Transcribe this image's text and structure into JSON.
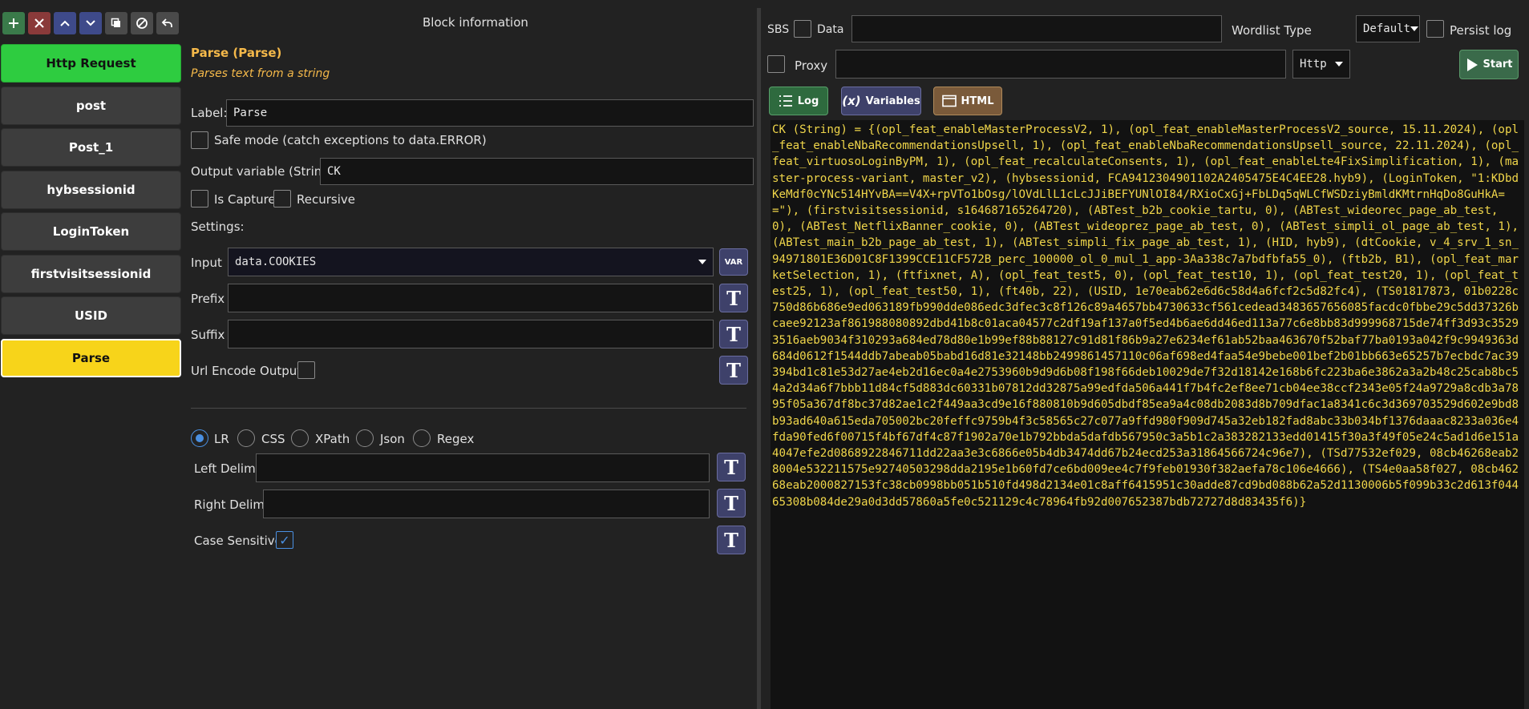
{
  "toolbar": {
    "icons": [
      "plus-icon",
      "x-icon",
      "chevron-up-icon",
      "chevron-down-icon",
      "clone-icon",
      "disable-icon",
      "undo-icon"
    ]
  },
  "blocks": [
    {
      "label": "Http Request",
      "kind": "request"
    },
    {
      "label": "post",
      "kind": "normal"
    },
    {
      "label": "Post_1",
      "kind": "normal"
    },
    {
      "label": "hybsessionid",
      "kind": "normal"
    },
    {
      "label": "LoginToken",
      "kind": "normal"
    },
    {
      "label": "firstvisitsessionid",
      "kind": "normal"
    },
    {
      "label": "USID",
      "kind": "normal"
    },
    {
      "label": "Parse",
      "kind": "selected"
    }
  ],
  "block_info": {
    "header": "Block information",
    "title": "Parse (Parse)",
    "description": "Parses text from a string",
    "label_label": "Label:",
    "label_value": "Parse",
    "safe_mode_label": "Safe mode (catch exceptions to data.ERROR)",
    "output_label": "Output variable (String)",
    "output_value": "CK",
    "is_capture_label": "Is Capture",
    "recursive_label": "Recursive",
    "settings_label": "Settings:",
    "input_label": "Input",
    "input_value": "data.COOKIES",
    "var_button": "VAR",
    "prefix_label": "Prefix",
    "suffix_label": "Suffix",
    "url_encode_label": "Url Encode Output",
    "t_glyph": "T",
    "modes": [
      "LR",
      "CSS",
      "XPath",
      "Json",
      "Regex"
    ],
    "selected_mode": "LR",
    "left_delim_label": "Left Delim",
    "right_delim_label": "Right Delim",
    "case_sensitive_label": "Case Sensitive",
    "case_sensitive_mark": "✓"
  },
  "debugger": {
    "sbs_label": "SBS",
    "data_label": "Data",
    "wordlist_label": "Wordlist Type",
    "wordlist_value": "Default",
    "persist_label": "Persist log",
    "proxy_label": "Proxy",
    "proxy_type": "Http",
    "start_label": "Start",
    "log_label": "Log",
    "variables_label": "Variables",
    "variables_glyph": "(x)",
    "html_label": "HTML",
    "output": "CK (String) = {(opl_feat_enableMasterProcessV2, 1), (opl_feat_enableMasterProcessV2_source, 15.11.2024), (opl_feat_enableNbaRecommendationsUpsell, 1), (opl_feat_enableNbaRecommendationsUpsell_source, 22.11.2024), (opl_feat_virtuosoLoginByPM, 1), (opl_feat_recalculateConsents, 1), (opl_feat_enableLte4FixSimplification, 1), (master-process-variant, master_v2), (hybsessionid, FCA9412304901102A2405475E4C4EE28.hyb9), (LoginToken, \"1:KDbdKeMdf0cYNc514HYvBA==V4X+rpVTo1bOsg/lOVdLlL1cLcJJiBEFYUNlOI84/RXioCxGj+FbLDq5qWLCfWSDziyBmldKMtrnHqDo8GuHkA==\"), (firstvisitsessionid, s164687165264720), (ABTest_b2b_cookie_tartu, 0), (ABTest_wideorec_page_ab_test, 0), (ABTest_NetflixBanner_cookie, 0), (ABTest_wideoprez_page_ab_test, 0), (ABTest_simpli_ol_page_ab_test, 1), (ABTest_main_b2b_page_ab_test, 1), (ABTest_simpli_fix_page_ab_test, 1), (HID, hyb9), (dtCookie, v_4_srv_1_sn_94971801E36D01C8F1399CCE11CF572B_perc_100000_ol_0_mul_1_app-3Aa338c7a7bdfbfa55_0), (ftb2b, B1), (opl_feat_marketSelection, 1), (ftfixnet, A), (opl_feat_test5, 0), (opl_feat_test10, 1), (opl_feat_test20, 1), (opl_feat_test25, 1), (opl_feat_test50, 1), (ft40b, 22), (USID, 1e70eab62e6d6c58d4a6fcf2c5d82fc4), (TS01817873, 01b0228c750d86b686e9ed063189fb990dde086edc3dfec3c8f126c89a4657bb4730633cf561cedead3483657656085facdc0fbbe29c5dd37326bcaee92123af861988080892dbd41b8c01aca04577c2df19af137a0f5ed4b6ae6dd46ed113a77c6e8bb83d999968715de74ff3d93c35293516aeb9034f310293a684ed78d80e1b99ef88b88127c91d81f86b9a27e6234ef61ab52baa463670f52baf77ba0193a042f9c9949363d684d0612f1544ddb7abeab05babd16d81e32148bb2499861457110c06af698ed4faa54e9bebe001bef2b01bb663e65257b7ecbdc7ac39394bd1c81e53d27ae4eb2d16ec0a4e2753960b9d9d6b08f198f66deb10029de7f32d18142e168b6fc223ba6e3862a3a2b48c25cab8bc54a2d34a6f7bbb11d84cf5d883dc60331b07812dd32875a99edfda506a441f7b4fc2ef8ee71cb04ee38ccf2343e05f24a9729a8cdb3a7895f05a367df8bc37d82ae1c2f449aa3cd9e16f880810b9d605dbdf85ea9a4c08db2083d8b709dfac1a8341c6c3d369703529d602e9bd8b93ad640a615eda705002bc20feffc9759b4f3c58565c27c077a9ffd980f909d745a32eb182fad8abc33b034bf1376daaac8233a036e4fda90fed6f00715f4bf67df4c87f1902a70e1b792bbda5dafdb567950c3a5b1c2a383282133edd01415f30a3f49f05e24c5ad1d6e151a4047efe2d0868922846711dd22aa3e3c6866e05b4db3474dd67b24ecd253a31864566724c96e7), (TSd77532ef029, 08cb46268eab28004e532211575e92740503298dda2195e1b60fd7ce6bd009ee4c7f9feb01930f382aefa78c106e4666), (TS4e0aa58f027, 08cb46268eab2000827153fc38cb0998bb051b510fd498d2134e01c8aff6415951c30adde87cd9bd088b62a52d1130006b5f099b33c2d613f04465308b084de29a0d3dd57860a5fe0c521129c4c78964fb92d007652387bdb72727d8d83435f6)}"
  },
  "colors": {
    "accent_blue": "#4a90e2",
    "request_green": "#2ecc40",
    "selected_yellow": "#f7d41a",
    "log_text": "#f0d64a",
    "orange_title": "#f5b94a"
  }
}
